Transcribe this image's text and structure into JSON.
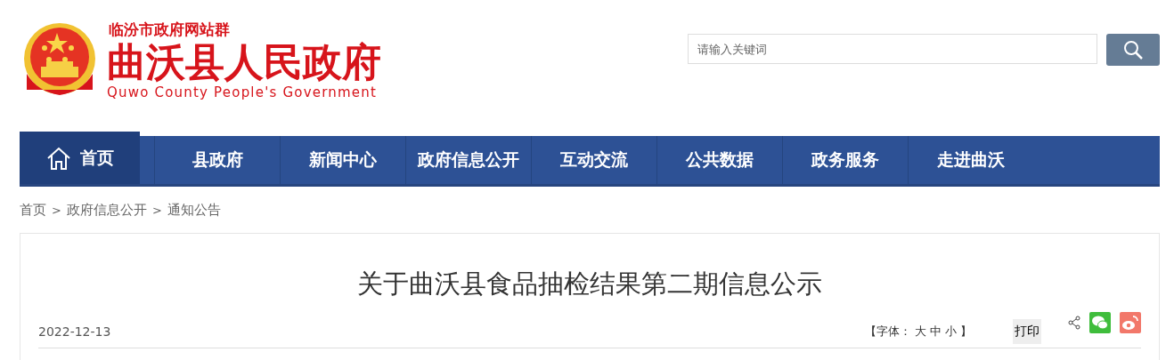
{
  "header": {
    "site_group": "临汾市政府网站群",
    "site_name": "曲沃县人民政府",
    "site_name_en": "Quwo County People's Government"
  },
  "search": {
    "placeholder": "请输入关键词"
  },
  "nav": [
    {
      "label": "首页",
      "selected": true
    },
    {
      "label": "县政府",
      "selected": false
    },
    {
      "label": "新闻中心",
      "selected": false
    },
    {
      "label": "政府信息公开",
      "selected": false
    },
    {
      "label": "互动交流",
      "selected": false
    },
    {
      "label": "公共数据",
      "selected": false
    },
    {
      "label": "政务服务",
      "selected": false
    },
    {
      "label": "走进曲沃",
      "selected": false
    }
  ],
  "breadcrumb": {
    "separator": ">",
    "items": [
      "首页",
      "政府信息公开",
      "通知公告"
    ]
  },
  "article": {
    "title": "关于曲沃县食品抽检结果第二期信息公示",
    "date": "2022-12-13",
    "font_size": {
      "prefix": "【字体：",
      "sizes": [
        "大",
        "中",
        "小"
      ],
      "suffix": "】"
    },
    "print": "打印"
  }
}
